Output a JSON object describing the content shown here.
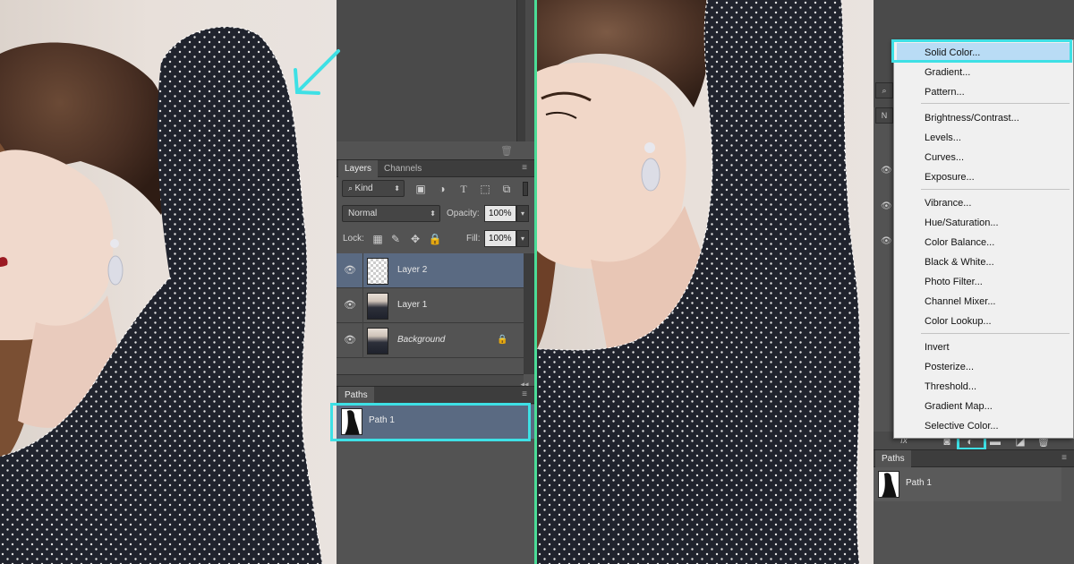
{
  "left_panel": {
    "tabs": [
      "Layers",
      "Channels"
    ],
    "filter_kind": "Kind",
    "blend_mode": "Normal",
    "opacity_label": "Opacity:",
    "opacity_value": "100%",
    "lock_label": "Lock:",
    "fill_label": "Fill:",
    "fill_value": "100%",
    "layers": [
      {
        "name": "Layer 2",
        "selected": true,
        "thumb": "transparent"
      },
      {
        "name": "Layer 1",
        "selected": false,
        "thumb": "photo"
      },
      {
        "name": "Background",
        "selected": false,
        "thumb": "photo",
        "locked": true
      }
    ],
    "paths_tab": "Paths",
    "path_name": "Path 1"
  },
  "right_panel": {
    "paths_tab": "Paths",
    "path_name": "Path 1"
  },
  "adjustment_menu": {
    "groups": [
      [
        "Solid Color...",
        "Gradient...",
        "Pattern..."
      ],
      [
        "Brightness/Contrast...",
        "Levels...",
        "Curves...",
        "Exposure..."
      ],
      [
        "Vibrance...",
        "Hue/Saturation...",
        "Color Balance...",
        "Black & White...",
        "Photo Filter...",
        "Channel Mixer...",
        "Color Lookup..."
      ],
      [
        "Invert",
        "Posterize...",
        "Threshold...",
        "Gradient Map...",
        "Selective Color..."
      ]
    ],
    "highlighted": "Solid Color..."
  },
  "colors": {
    "highlight": "#3ee0e5",
    "divider": "#4bdc97",
    "selection": "#5a6a82",
    "menu_highlight": "#b9dcf5"
  },
  "icons": [
    "eye-icon",
    "lock-icon",
    "trash-icon",
    "search-icon",
    "pixel-filter-icon",
    "adjustment-filter-icon",
    "type-filter-icon",
    "shape-filter-icon",
    "smart-object-filter-icon",
    "move-icon",
    "brush-icon",
    "checker-lock-icon",
    "panel-menu-icon",
    "collapse-icon",
    "fx-icon",
    "mask-icon",
    "new-adjustment-layer-icon",
    "folder-icon",
    "new-layer-icon"
  ]
}
